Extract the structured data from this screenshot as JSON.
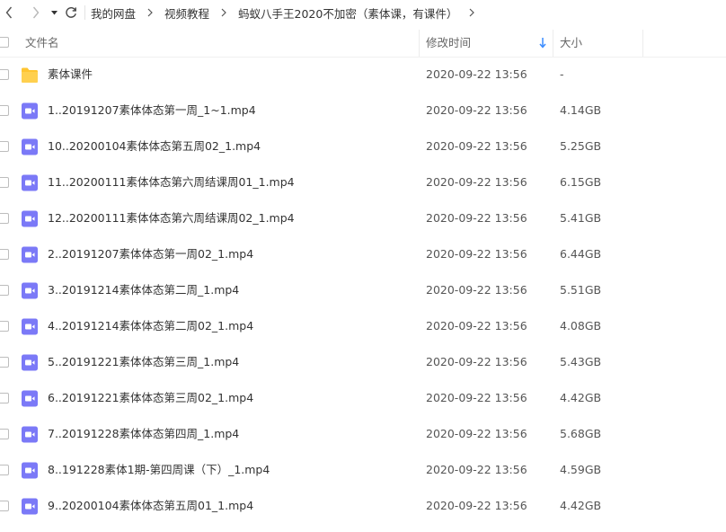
{
  "breadcrumb": [
    "我的网盘",
    "视频教程",
    "蚂蚁八手王2020不加密（素体课，有课件）"
  ],
  "columns": {
    "name": "文件名",
    "modified": "修改时间",
    "size": "大小"
  },
  "colors": {
    "accent": "#3b8cff",
    "folder": "#ffc531",
    "video": "#7b79f7"
  },
  "files": [
    {
      "name": "素体课件",
      "type": "folder",
      "modified": "2020-09-22 13:56",
      "size": "-"
    },
    {
      "name": "1..20191207素体体态第一周_1~1.mp4",
      "type": "video",
      "modified": "2020-09-22 13:56",
      "size": "4.14GB"
    },
    {
      "name": "10..20200104素体体态第五周02_1.mp4",
      "type": "video",
      "modified": "2020-09-22 13:56",
      "size": "5.25GB"
    },
    {
      "name": "11..20200111素体体态第六周结课周01_1.mp4",
      "type": "video",
      "modified": "2020-09-22 13:56",
      "size": "6.15GB"
    },
    {
      "name": "12..20200111素体体态第六周结课周02_1.mp4",
      "type": "video",
      "modified": "2020-09-22 13:56",
      "size": "5.41GB"
    },
    {
      "name": "2..20191207素体体态第一周02_1.mp4",
      "type": "video",
      "modified": "2020-09-22 13:56",
      "size": "6.44GB"
    },
    {
      "name": "3..20191214素体体态第二周_1.mp4",
      "type": "video",
      "modified": "2020-09-22 13:56",
      "size": "5.51GB"
    },
    {
      "name": "4..20191214素体体态第二周02_1.mp4",
      "type": "video",
      "modified": "2020-09-22 13:56",
      "size": "4.08GB"
    },
    {
      "name": "5..20191221素体体态第三周_1.mp4",
      "type": "video",
      "modified": "2020-09-22 13:56",
      "size": "5.43GB"
    },
    {
      "name": "6..20191221素体体态第三周02_1.mp4",
      "type": "video",
      "modified": "2020-09-22 13:56",
      "size": "4.42GB"
    },
    {
      "name": "7..20191228素体体态第四周_1.mp4",
      "type": "video",
      "modified": "2020-09-22 13:56",
      "size": "5.68GB"
    },
    {
      "name": "8..191228素体1期-第四周课（下）_1.mp4",
      "type": "video",
      "modified": "2020-09-22 13:56",
      "size": "4.59GB"
    },
    {
      "name": "9..20200104素体体态第五周01_1.mp4",
      "type": "video",
      "modified": "2020-09-22 13:56",
      "size": "4.42GB"
    }
  ]
}
